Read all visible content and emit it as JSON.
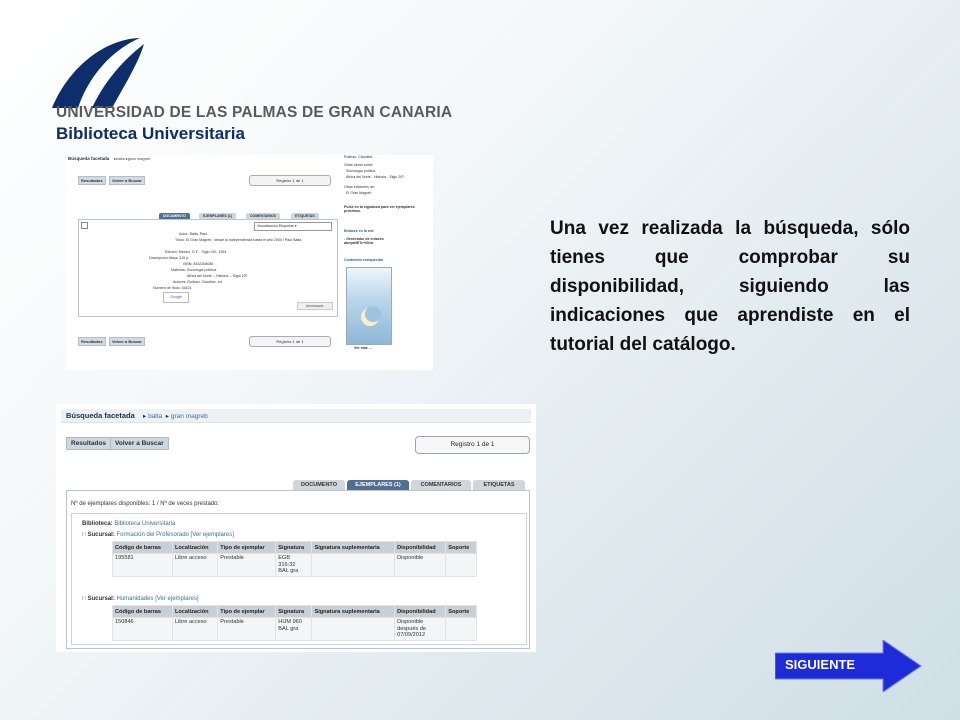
{
  "logo": {
    "university": "UNIVERSIDAD DE LAS PALMAS DE GRAN CANARIA",
    "library": "Biblioteca Universitaria",
    "brand_color": "#0d2d6b"
  },
  "description": "Una vez realizada la búsqueda, sólo tienes que comprobar su disponibilidad, siguiendo las indicaciones que aprendiste en el tutorial del catálogo.",
  "small_shot": {
    "crumb_title": "Búsqueda facetada",
    "crumbs": [
      "balta",
      "gran magreb"
    ],
    "btn_results": "Resultados",
    "btn_back": "Volver a Buscar",
    "record": "Registro 1 de 1",
    "tabs": [
      "DOCUMENTO",
      "EJEMPLARES (1)",
      "COMENTARIOS",
      "ETIQUETAS"
    ],
    "view_select": "Visualización Etiquetas",
    "fields": [
      "Autor: Balta, Paul.",
      "Título: El Gran Magreb : desde la independencia hasta el año 2000 / Paul Balta",
      "Edición: Mexico, D.F. : Siglo XXI, 1994.",
      "Descripción física: 315 p.",
      "ISBN: 8432308088",
      "Materias: Sociología política.",
      "África del Norte -- Historia -- Siglo 20º.",
      "Autores: Rulleau, Claudine, ed.",
      "Número de título: 54424"
    ],
    "google_label": "Google",
    "bookmark": "BOOKMARK",
    "side_items": [
      "Rulleau, Claudine,",
      "Otras obras sobre",
      "Sociología política.",
      "África del Norte - Historia - Siglo 20º.",
      "Otras ediciones de:",
      "El Gran Magreb",
      "Pulse en la signatura para ver ejemplares próximos.",
      "Enlaces en la red:",
      "- Generador de enlaces abeyaNETc+I/link",
      "Contenido enriquecido",
      "Ver más ..."
    ]
  },
  "big_shot": {
    "crumb_title": "Búsqueda facetada",
    "crumb1": "balta",
    "crumb2": "gran magreb",
    "btn_results": "Resultados",
    "btn_back": "Volver a Buscar",
    "record": "Registro 1 de 1",
    "tabs": [
      "DOCUMENTO",
      "EJEMPLARES (1)",
      "COMENTARIOS",
      "ETIQUETAS"
    ],
    "counts": "Nº de ejemplares disponibles: 1 / Nº de veces prestado:",
    "library_label": "Biblioteca:",
    "library_value": "Biblioteca Universitaria",
    "branch_label": "Sucursal:",
    "branches": [
      {
        "name": "Formación del Profesorado",
        "link": "[Ver ejemplares]"
      },
      {
        "name": "Humanidades",
        "link": "[Ver ejemplares]"
      }
    ],
    "columns": [
      "Código de barras",
      "Localización",
      "Tipo de ejemplar",
      "Signatura",
      "Signatura suplementaria",
      "Disponibilidad",
      "Soporte"
    ],
    "rows": [
      [
        "195581",
        "Libre acceso",
        "Prestable",
        "EGB\n316:32\nBAL gra",
        "",
        "Disponible",
        ""
      ],
      [
        "150846",
        "Libre acceso",
        "Prestable",
        "HUM 960\nBAL gra",
        "",
        "Disponible\ndespués de\n07/09/2012",
        ""
      ]
    ]
  },
  "next_button": {
    "label": "SIGUIENTE",
    "color": "#1e2bd8"
  }
}
